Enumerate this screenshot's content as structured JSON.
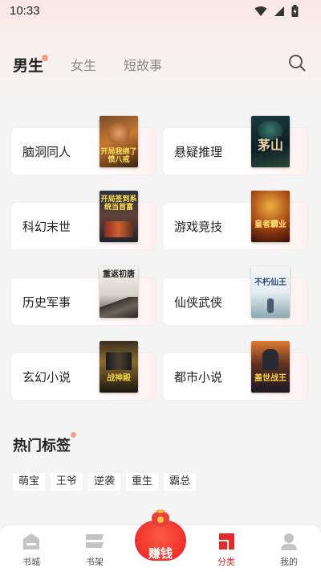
{
  "status_bar": {
    "time": "10:33"
  },
  "tabs": [
    {
      "label": "男生",
      "active": true
    },
    {
      "label": "女生",
      "active": false
    },
    {
      "label": "短故事",
      "active": false
    }
  ],
  "categories": [
    {
      "label": "脑洞同人",
      "cover_text": "开局我绑了愤八戒"
    },
    {
      "label": "悬疑推理",
      "cover_text": "茅山"
    },
    {
      "label": "科幻末世",
      "cover_text": "开局签到系统当首富"
    },
    {
      "label": "游戏竞技",
      "cover_text": "皇者霸业"
    },
    {
      "label": "历史军事",
      "cover_text": "重返初唐"
    },
    {
      "label": "仙侠武侠",
      "cover_text": "不朽仙王"
    },
    {
      "label": "玄幻小说",
      "cover_text": "战神殿"
    },
    {
      "label": "都市小说",
      "cover_text": "盖世战王"
    }
  ],
  "hot_tags": {
    "title": "热门标签",
    "tags": [
      "萌宝",
      "王爷",
      "逆袭",
      "重生",
      "霸总"
    ]
  },
  "bottom_nav": {
    "items": [
      {
        "label": "书城",
        "icon": "bookstore-icon",
        "active": false
      },
      {
        "label": "书架",
        "icon": "bookshelf-icon",
        "active": false
      },
      {
        "label": "分类",
        "icon": "category-icon",
        "active": true
      },
      {
        "label": "我的",
        "icon": "profile-icon",
        "active": false
      }
    ],
    "earn_label": "赚钱"
  },
  "colors": {
    "accent": "#e62a2a",
    "background": "#f4f4f4",
    "dot": "#f0a08a"
  }
}
